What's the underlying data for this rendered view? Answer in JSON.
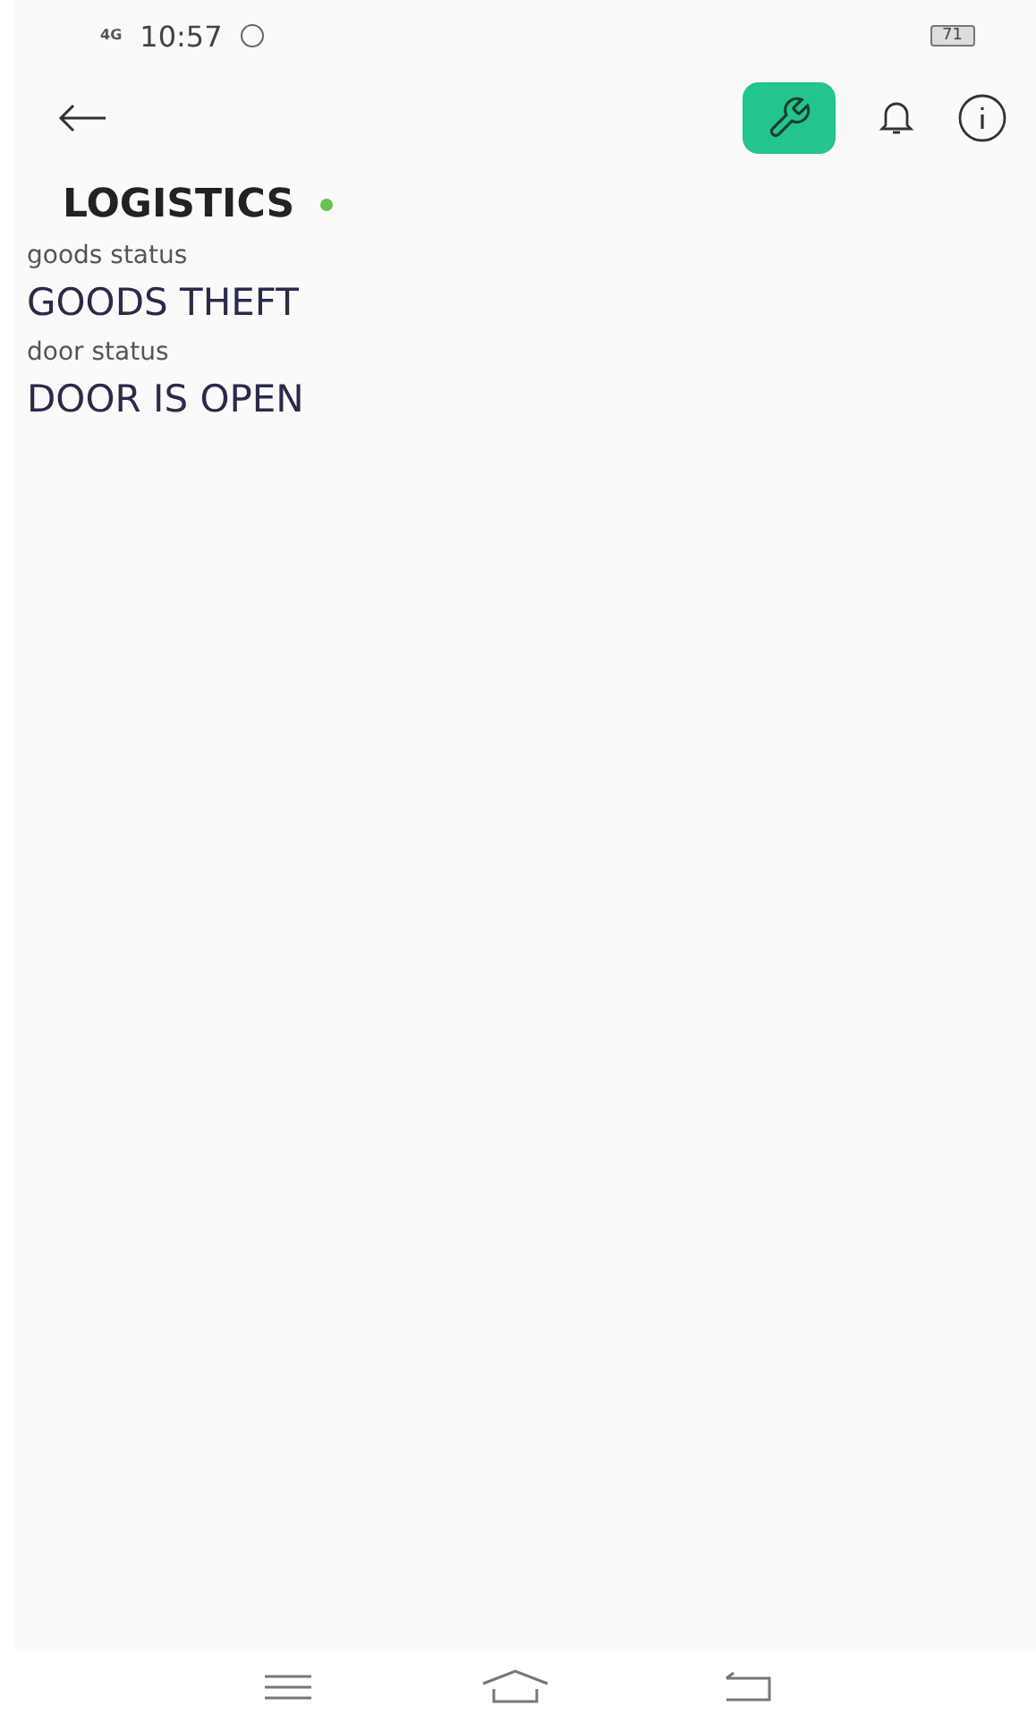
{
  "status_bar": {
    "network": "4G",
    "time": "10:57",
    "battery": "71"
  },
  "toolbar": {
    "settings_active": true
  },
  "device": {
    "title": "LOGISTICS",
    "online": true
  },
  "fields": [
    {
      "label": "goods status",
      "value": "GOODS THEFT"
    },
    {
      "label": "door status",
      "value": "DOOR IS OPEN"
    }
  ]
}
